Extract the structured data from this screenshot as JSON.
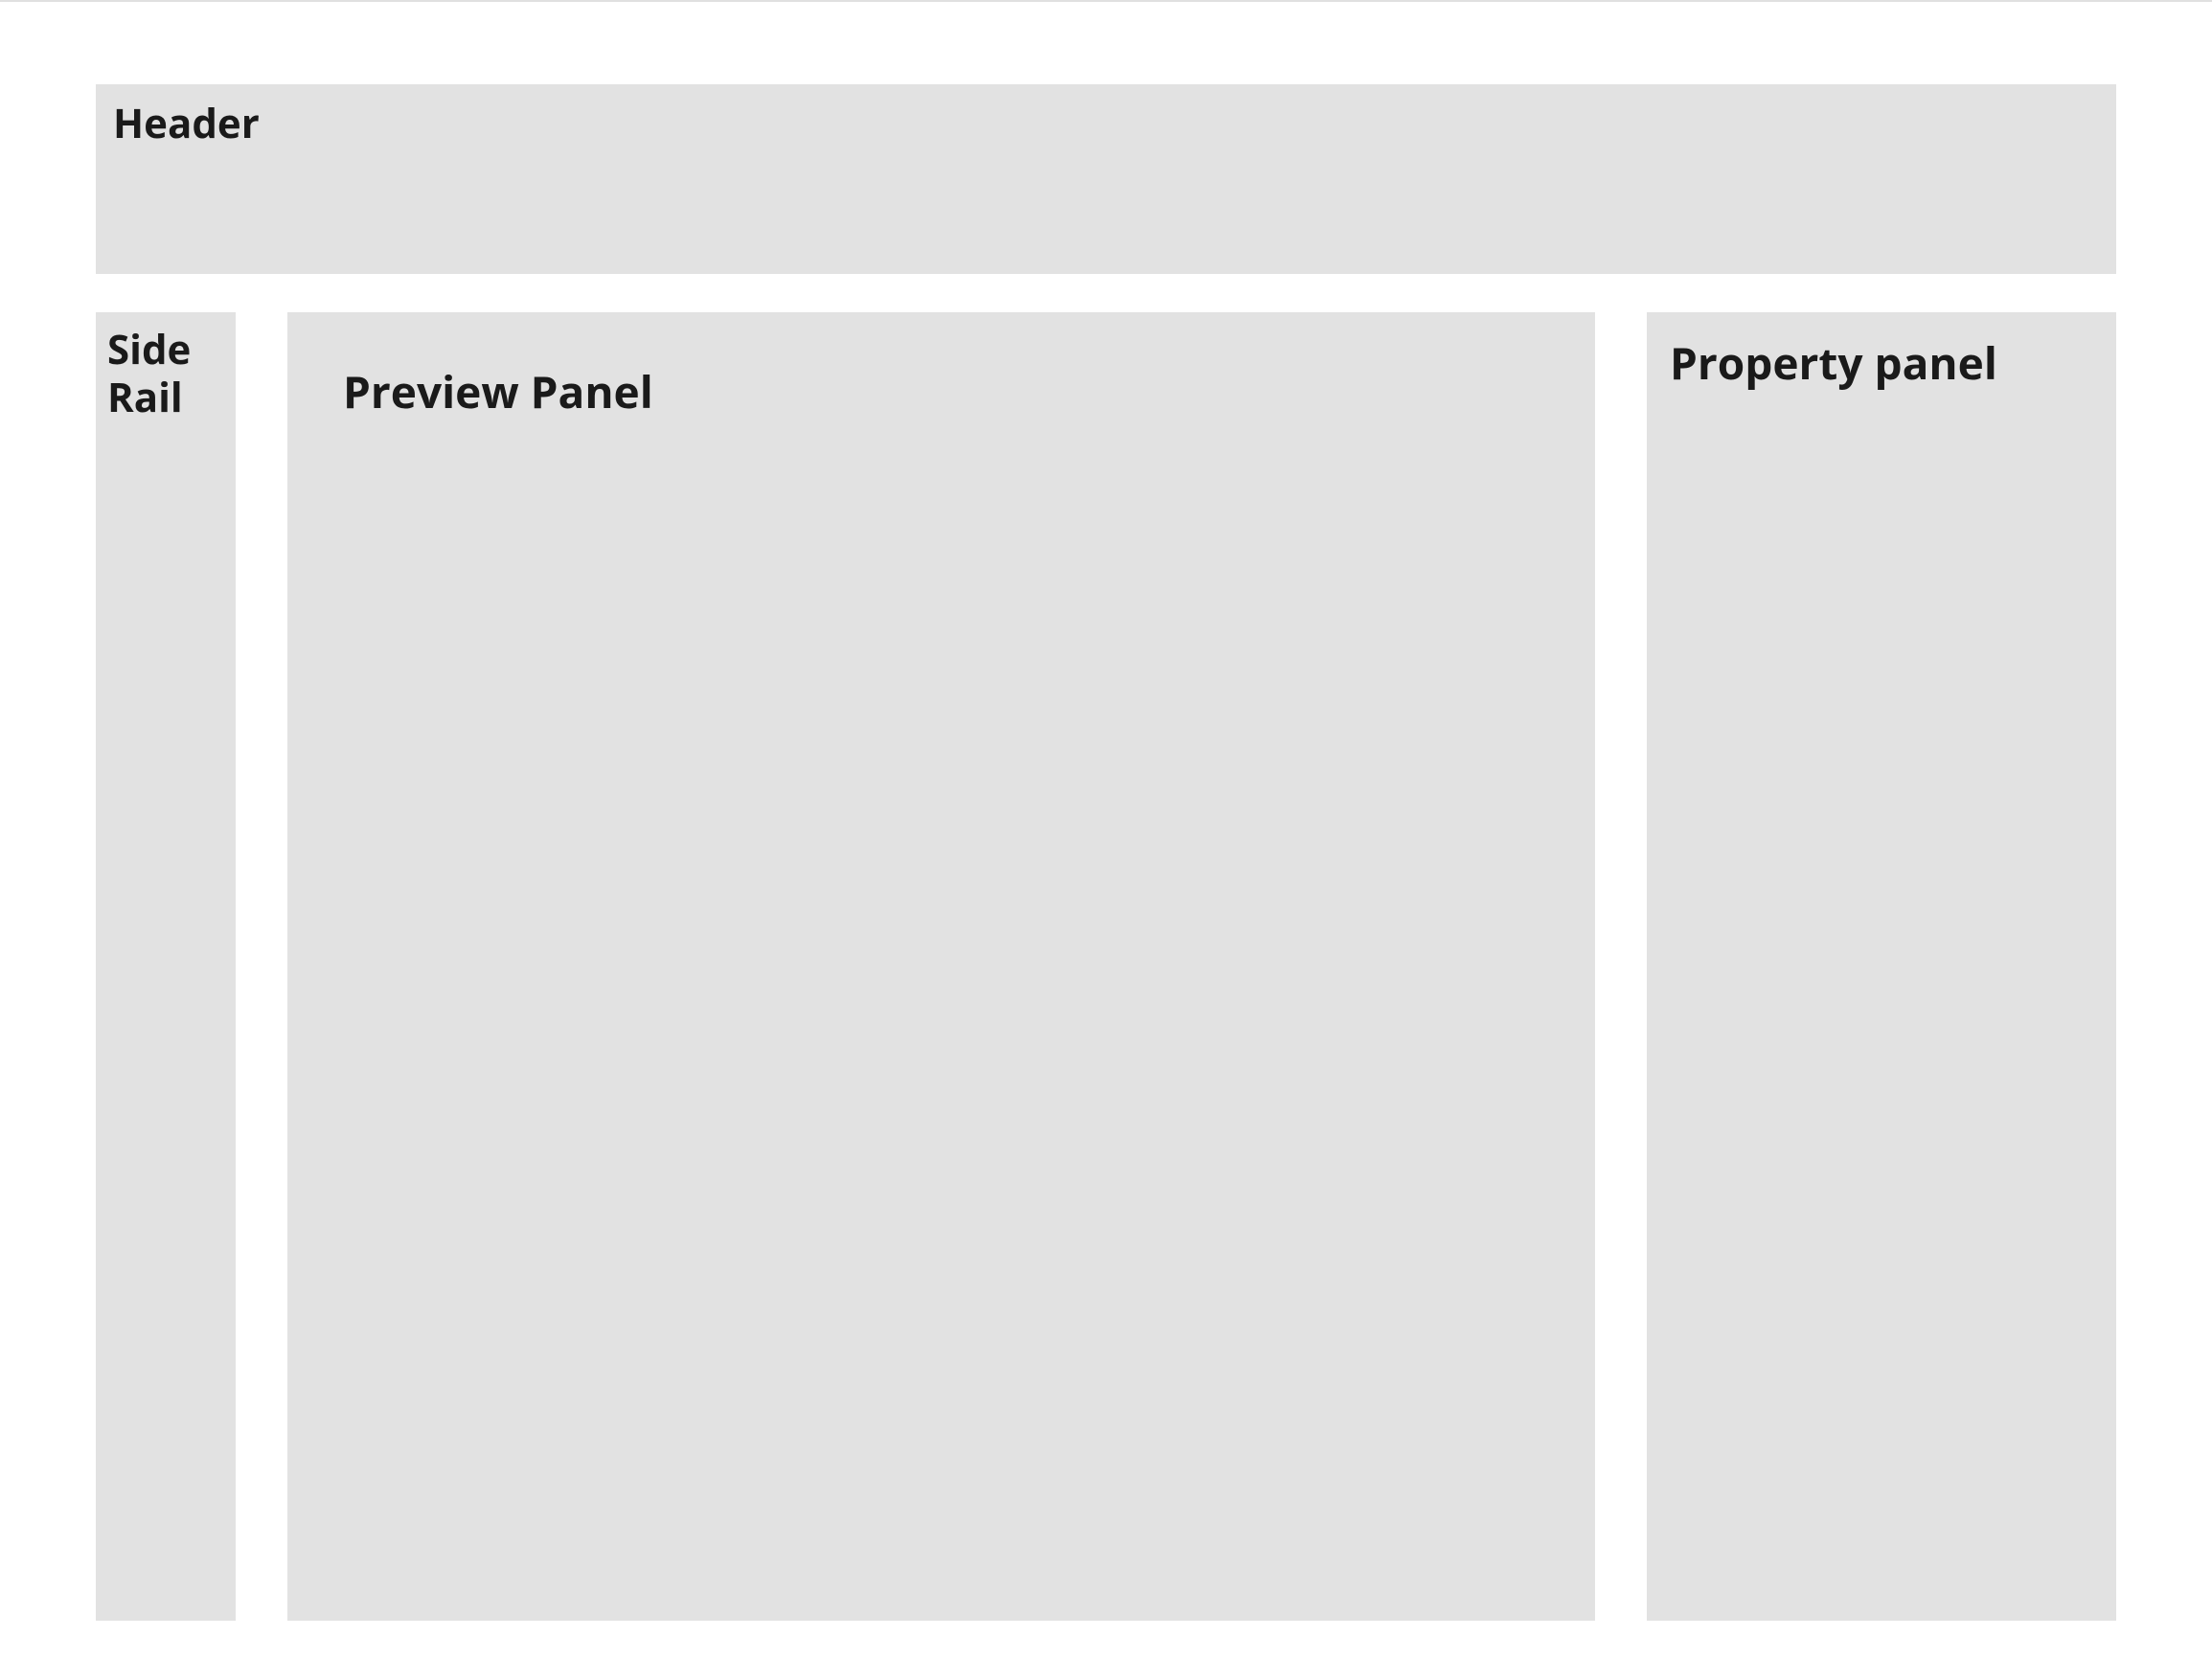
{
  "header": {
    "title": "Header"
  },
  "side_rail": {
    "title": "Side Rail"
  },
  "preview_panel": {
    "title": "Preview Panel"
  },
  "property_panel": {
    "title": "Property panel"
  }
}
